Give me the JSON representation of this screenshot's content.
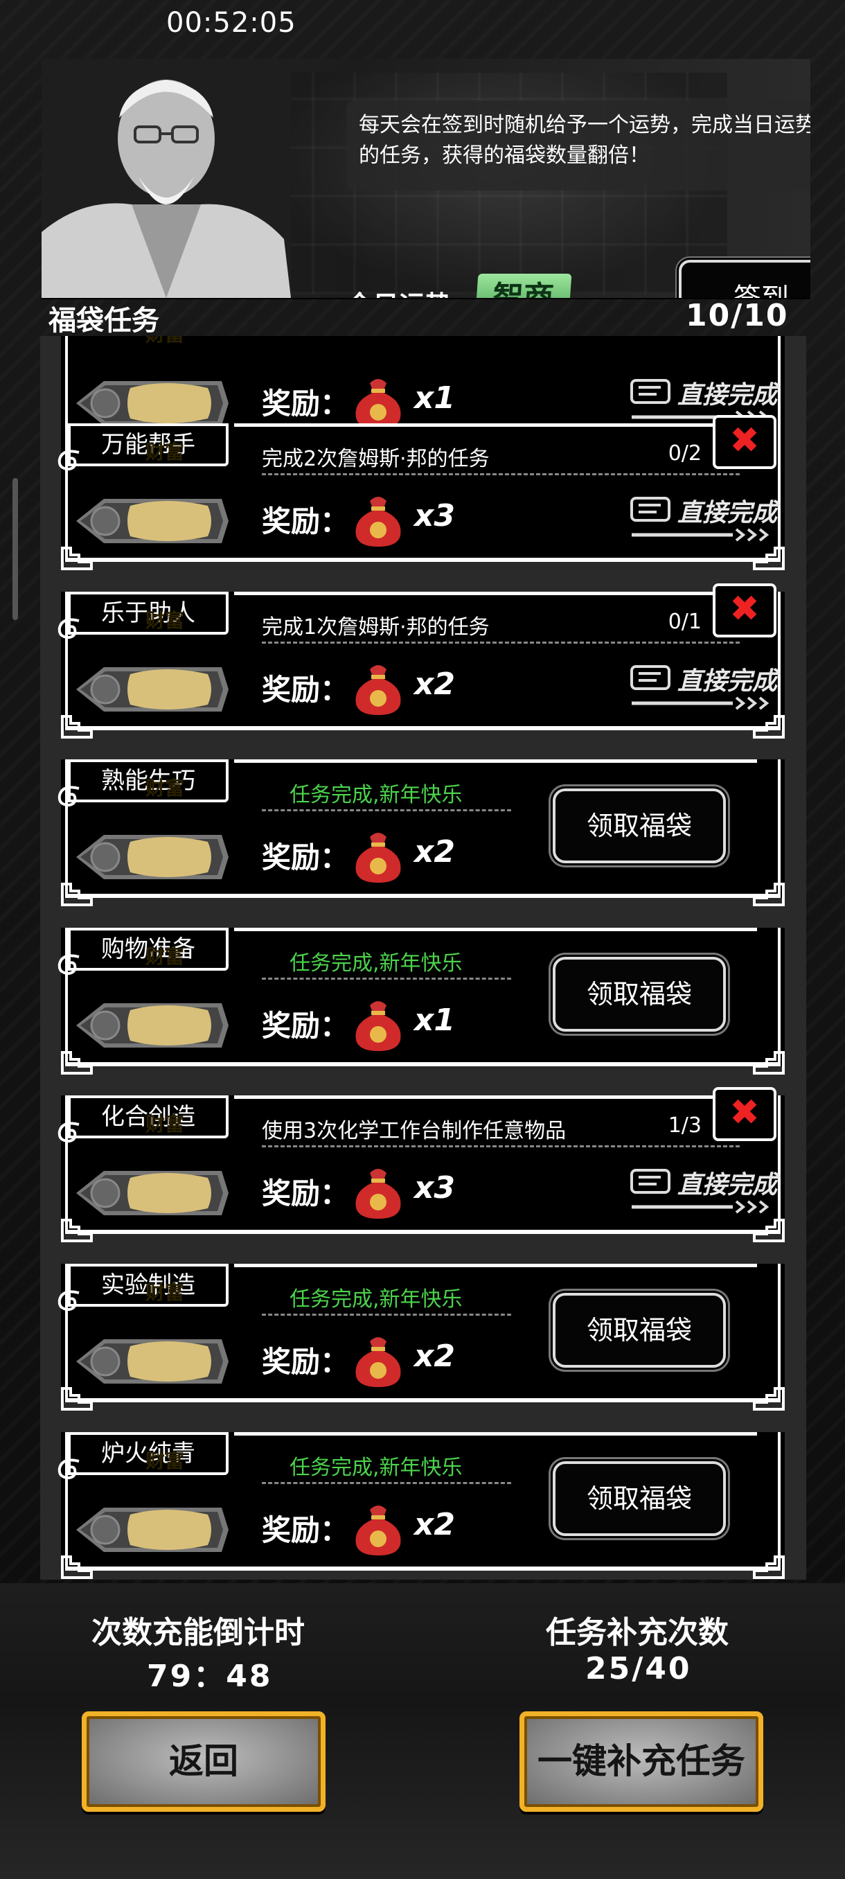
{
  "status_bar": {
    "time": "00:52:05"
  },
  "header": {
    "npc_speech": "每天会在签到时随机给予一个运势，完成当日运势的任务，获得的福袋数量翻倍！",
    "fortune_label": "今日运势",
    "fortune_value": "智商",
    "signin_label": "签到"
  },
  "panel": {
    "title": "福袋任务",
    "count": "10/10"
  },
  "common": {
    "wealth_tag": "财富",
    "reward_label": "奖励：",
    "direct_complete": "直接完成",
    "claim_label": "领取福袋",
    "close_symbol": "✖",
    "done_text": "任务完成,新年快乐"
  },
  "tasks": [
    {
      "name": "",
      "desc": "",
      "progress": "",
      "multiplier": "x1",
      "state": "partial-top"
    },
    {
      "name": "万能帮手",
      "desc": "完成2次詹姆斯·邦的任务",
      "progress": "0/2",
      "multiplier": "x3",
      "state": "in-progress"
    },
    {
      "name": "乐于助人",
      "desc": "完成1次詹姆斯·邦的任务",
      "progress": "0/1",
      "multiplier": "x2",
      "state": "in-progress"
    },
    {
      "name": "熟能生巧",
      "desc": "",
      "progress": "",
      "multiplier": "x2",
      "state": "done"
    },
    {
      "name": "购物准备",
      "desc": "",
      "progress": "",
      "multiplier": "x1",
      "state": "done"
    },
    {
      "name": "化合创造",
      "desc": "使用3次化学工作台制作任意物品",
      "progress": "1/3",
      "multiplier": "x3",
      "state": "in-progress"
    },
    {
      "name": "实验制造",
      "desc": "",
      "progress": "",
      "multiplier": "x2",
      "state": "done"
    },
    {
      "name": "炉火纯青",
      "desc": "",
      "progress": "",
      "multiplier": "x2",
      "state": "done"
    }
  ],
  "footer": {
    "recharge_label": "次数充能倒计时",
    "recharge_value": "79：48",
    "refill_label": "任务补充次数",
    "refill_value": "25/40",
    "back_label": "返回",
    "refill_all_label": "一键补充任务"
  },
  "colors": {
    "done_green": "#4cd34c",
    "close_red": "#e22222",
    "gold_border": "#f2b227",
    "fortune_green": "#5fbf6a"
  }
}
